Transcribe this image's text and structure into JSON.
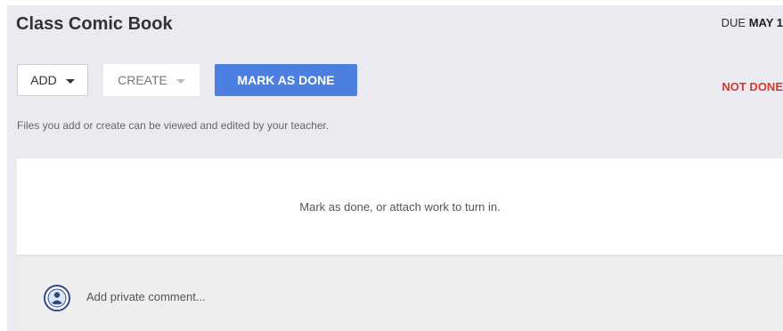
{
  "assignment": {
    "title": "Class Comic Book",
    "due_prefix": "DUE",
    "due_date": "MAY 1",
    "status": "NOT DONE",
    "status_color": "#d03a2f"
  },
  "toolbar": {
    "add_label": "ADD",
    "create_label": "CREATE",
    "mark_done_label": "MARK AS DONE",
    "accent_color": "#4d7fe0"
  },
  "helper_text": "Files you add or create can be viewed and edited by your teacher.",
  "work_panel": {
    "message": "Mark as done, or attach work to turn in."
  },
  "comment": {
    "placeholder": "Add private comment...",
    "avatar_icon": "user-avatar-icon"
  }
}
